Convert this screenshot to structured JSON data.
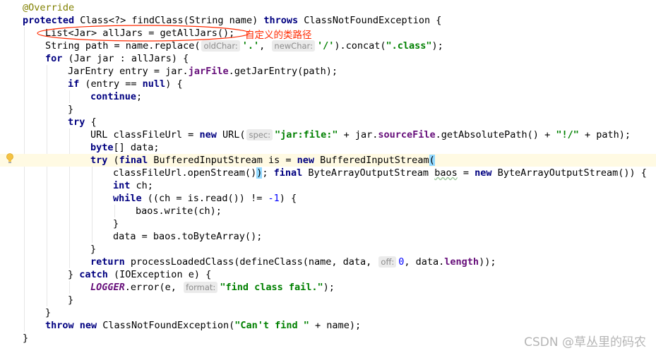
{
  "editor": {
    "language": "java",
    "highlighted_line": 12,
    "lines": [
      {
        "indent": 0,
        "tokens": [
          [
            "a",
            "@Override"
          ]
        ]
      },
      {
        "indent": 0,
        "tokens": [
          [
            "k",
            "protected"
          ],
          [
            "p",
            " Class<?> findClass(String name) "
          ],
          [
            "k",
            "throws"
          ],
          [
            "p",
            " ClassNotFoundException {"
          ]
        ]
      },
      {
        "indent": 1,
        "tokens": [
          [
            "p",
            "List<Jar> allJars = getAllJars();"
          ]
        ]
      },
      {
        "indent": 1,
        "tokens": [
          [
            "p",
            "String path = name.replace("
          ],
          [
            "h",
            "oldChar:"
          ],
          [
            "s",
            "'.'"
          ],
          [
            "p",
            ", "
          ],
          [
            "h",
            "newChar:"
          ],
          [
            "s",
            "'/'"
          ],
          [
            "p",
            ").concat("
          ],
          [
            "s",
            "\".class\""
          ],
          [
            "p",
            ");"
          ]
        ]
      },
      {
        "indent": 1,
        "tokens": [
          [
            "k",
            "for"
          ],
          [
            "p",
            " (Jar jar : allJars) {"
          ]
        ]
      },
      {
        "indent": 2,
        "tokens": [
          [
            "p",
            "JarEntry entry = jar."
          ],
          [
            "f",
            "jarFile"
          ],
          [
            "p",
            ".getJarEntry(path);"
          ]
        ]
      },
      {
        "indent": 2,
        "tokens": [
          [
            "k",
            "if"
          ],
          [
            "p",
            " (entry == "
          ],
          [
            "k",
            "null"
          ],
          [
            "p",
            ") {"
          ]
        ]
      },
      {
        "indent": 3,
        "tokens": [
          [
            "k",
            "continue"
          ],
          [
            "p",
            ";"
          ]
        ]
      },
      {
        "indent": 2,
        "tokens": [
          [
            "p",
            "}"
          ]
        ]
      },
      {
        "indent": 2,
        "tokens": [
          [
            "k",
            "try"
          ],
          [
            "p",
            " {"
          ]
        ]
      },
      {
        "indent": 3,
        "tokens": [
          [
            "p",
            "URL classFileUrl = "
          ],
          [
            "k",
            "new"
          ],
          [
            "p",
            " URL("
          ],
          [
            "h",
            "spec:"
          ],
          [
            "s",
            "\"jar:file:\""
          ],
          [
            "p",
            " + jar."
          ],
          [
            "f",
            "sourceFile"
          ],
          [
            "p",
            ".getAbsolutePath() + "
          ],
          [
            "s",
            "\"!/\""
          ],
          [
            "p",
            " + path);"
          ]
        ]
      },
      {
        "indent": 3,
        "tokens": [
          [
            "k",
            "byte"
          ],
          [
            "p",
            "[] data;"
          ]
        ]
      },
      {
        "indent": 3,
        "tokens": [
          [
            "k",
            "try"
          ],
          [
            "p",
            " ("
          ],
          [
            "k",
            "final"
          ],
          [
            "p",
            " BufferedInputStream is = "
          ],
          [
            "k",
            "new"
          ],
          [
            "p",
            " BufferedInputStream"
          ],
          [
            "bm",
            "("
          ]
        ]
      },
      {
        "indent": 4,
        "tokens": [
          [
            "p",
            "classFileUrl.openStream()"
          ],
          [
            "bm",
            ")"
          ],
          [
            "p",
            "; "
          ],
          [
            "k",
            "final"
          ],
          [
            "p",
            " ByteArrayOutputStream "
          ],
          [
            "wv",
            "baos"
          ],
          [
            "p",
            " = "
          ],
          [
            "k",
            "new"
          ],
          [
            "p",
            " ByteArrayOutputStream()) {"
          ]
        ]
      },
      {
        "indent": 4,
        "tokens": [
          [
            "k",
            "int"
          ],
          [
            "p",
            " ch;"
          ]
        ]
      },
      {
        "indent": 4,
        "tokens": [
          [
            "k",
            "while"
          ],
          [
            "p",
            " ((ch = is.read()) != "
          ],
          [
            "n",
            "-1"
          ],
          [
            "p",
            ") {"
          ]
        ]
      },
      {
        "indent": 5,
        "tokens": [
          [
            "p",
            "baos.write(ch);"
          ]
        ]
      },
      {
        "indent": 4,
        "tokens": [
          [
            "p",
            "}"
          ]
        ]
      },
      {
        "indent": 4,
        "tokens": [
          [
            "p",
            "data = baos.toByteArray();"
          ]
        ]
      },
      {
        "indent": 3,
        "tokens": [
          [
            "p",
            "}"
          ]
        ]
      },
      {
        "indent": 3,
        "tokens": [
          [
            "k",
            "return"
          ],
          [
            "p",
            " processLoadedClass(defineClass(name, data, "
          ],
          [
            "h",
            "off:"
          ],
          [
            "n",
            "0"
          ],
          [
            "p",
            ", data."
          ],
          [
            "f",
            "length"
          ],
          [
            "p",
            "));"
          ]
        ]
      },
      {
        "indent": 2,
        "tokens": [
          [
            "p",
            "} "
          ],
          [
            "k",
            "catch"
          ],
          [
            "p",
            " (IOException e) {"
          ]
        ]
      },
      {
        "indent": 3,
        "tokens": [
          [
            "st",
            "LOGGER"
          ],
          [
            "p",
            ".error(e, "
          ],
          [
            "h",
            "format:"
          ],
          [
            "s",
            "\"find class fail.\""
          ],
          [
            "p",
            ");"
          ]
        ]
      },
      {
        "indent": 2,
        "tokens": [
          [
            "p",
            "}"
          ]
        ]
      },
      {
        "indent": 1,
        "tokens": [
          [
            "p",
            "}"
          ]
        ]
      },
      {
        "indent": 1,
        "tokens": [
          [
            "k",
            "throw"
          ],
          [
            "p",
            " "
          ],
          [
            "k",
            "new"
          ],
          [
            "p",
            " ClassNotFoundException("
          ],
          [
            "s",
            "\"Can't find \""
          ],
          [
            "p",
            " + name);"
          ]
        ]
      },
      {
        "indent": 0,
        "tokens": [
          [
            "p",
            "}"
          ]
        ]
      }
    ]
  },
  "annotation": {
    "note": "自定义的类路径",
    "color": "#ff2a00"
  },
  "watermark": "CSDN @草丛里的码农",
  "colors": {
    "keyword": "#000080",
    "string": "#008000",
    "annotation": "#808000",
    "field": "#660e7a",
    "number": "#0000ff",
    "current_line": "#fffae3"
  }
}
